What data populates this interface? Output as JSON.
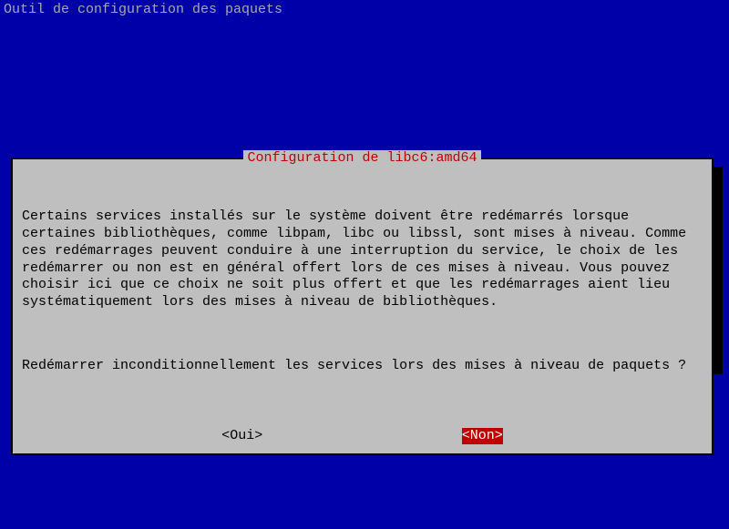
{
  "header": {
    "title": "Outil de configuration des paquets"
  },
  "dialog": {
    "title": " Configuration de libc6:amd64 ",
    "body1": "Certains services installés sur le système doivent être redémarrés lorsque certaines bibliothèques, comme libpam, libc ou libssl, sont mises à niveau. Comme ces redémarrages peuvent conduire à une interruption du service, le choix de les redémarrer ou non est en général offert lors de ces mises à niveau. Vous pouvez choisir ici que ce choix ne soit plus offert et que les redémarrages aient lieu systématiquement lors des mises à niveau de bibliothèques.",
    "body2": "Redémarrer inconditionnellement les services lors des mises à niveau de paquets ?",
    "buttons": {
      "yes": "<Oui>",
      "no": "<Non>"
    }
  }
}
